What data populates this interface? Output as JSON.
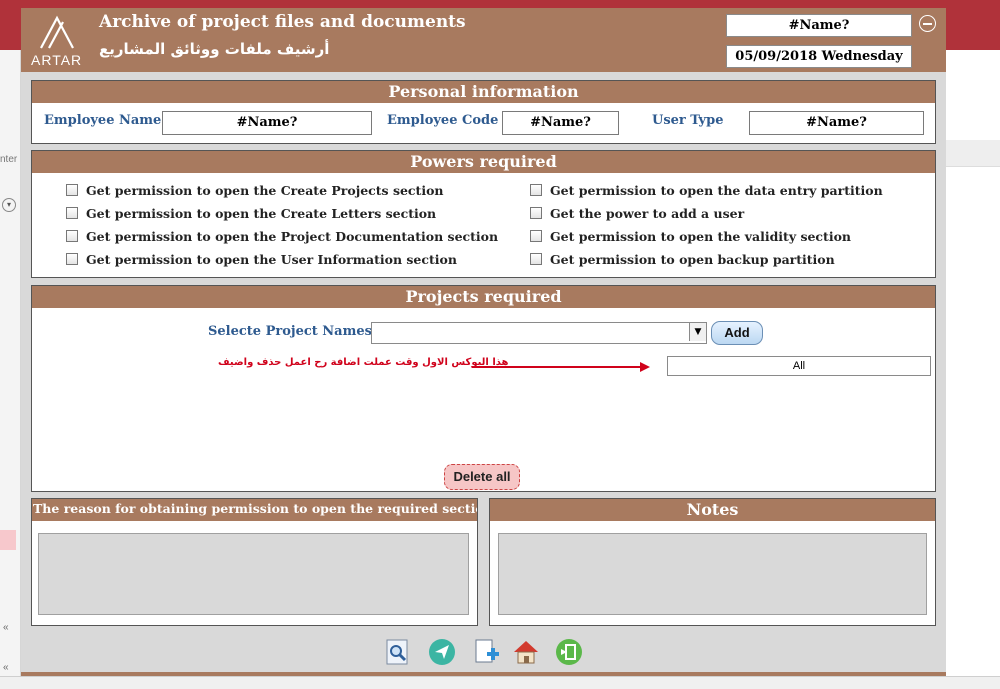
{
  "app": {
    "title_en": "Archive of project files and documents",
    "title_ar": "أرشيف ملفات ووثائق المشاريع",
    "logo_text": "ARTAR",
    "user_name_value": "#Name?",
    "date_value": "05/09/2018 Wednesday"
  },
  "background": {
    "left_text": "nter",
    "left_glyphs": [
      "«",
      "«"
    ]
  },
  "personal": {
    "title": "Personal information",
    "employee_name_label": "Employee Name",
    "employee_name_value": "#Name?",
    "employee_code_label": "Employee Code",
    "employee_code_value": "#Name?",
    "user_type_label": "User Type",
    "user_type_value": "#Name?"
  },
  "powers": {
    "title": "Powers required",
    "left": [
      "Get permission to open the Create Projects section",
      "Get permission to open the Create Letters section",
      "Get permission to open the Project Documentation section",
      "Get permission to open the User Information section"
    ],
    "right": [
      "Get permission to open the data entry partition",
      "Get the power to add a user",
      "Get permission to open the validity section",
      "Get permission to open backup partition"
    ]
  },
  "projects": {
    "title": "Projects required",
    "select_label": "Selecte Project Names",
    "select_value": "",
    "add_label": "Add",
    "annotation_ar": "هذا البوكس الاول وقت عملت اضافة رح اعمل حذف واضيف",
    "list_first": "All",
    "delete_all_label": "Delete all"
  },
  "reason": {
    "title": "The reason for obtaining permission to open the required sections",
    "value": ""
  },
  "notes": {
    "title": "Notes",
    "value": ""
  },
  "colors": {
    "header_brown": "#a87a5f",
    "label_blue": "#2e5a8f",
    "arrow_red": "#d0021b",
    "top_bar": "#b0323a"
  },
  "footer_icons": [
    "search-document-icon",
    "send-icon",
    "new-document-icon",
    "home-icon",
    "exit-icon"
  ]
}
